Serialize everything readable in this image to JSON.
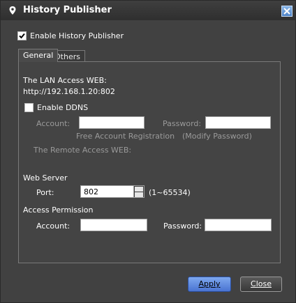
{
  "window": {
    "title": "History Publisher",
    "enable_history_publisher_label": "Enable History Publisher",
    "enable_history_publisher_checked": true
  },
  "tabs": [
    {
      "label": "General",
      "active": true
    },
    {
      "label": "Others",
      "active": false
    }
  ],
  "general": {
    "lan_access_label": "The LAN Access WEB:",
    "lan_access_url": "http://192.168.1.20:802",
    "enable_ddns_label": "Enable DDNS",
    "enable_ddns_checked": false,
    "ddns_account_label": "Account:",
    "ddns_account_value": "",
    "ddns_password_label": "Password:",
    "ddns_password_value": "",
    "free_registration_link": "Free Account Registration",
    "modify_password_link": "(Modify Password)",
    "remote_access_label": "The Remote Access WEB:",
    "web_server_heading": "Web Server",
    "port_label": "Port:",
    "port_value": "802",
    "port_range": "(1~65534)",
    "access_permission_heading": "Access Permission",
    "access_account_label": "Account:",
    "access_account_value": "",
    "access_password_label": "Password:",
    "access_password_value": ""
  },
  "buttons": {
    "apply_label": "Apply",
    "close_label": "Close"
  },
  "colors": {
    "window_bg": "#414141",
    "title_text": "#ffffff",
    "disabled_text": "#9a9a9a",
    "apply_button": "#5b87e0"
  },
  "icons": {
    "app_icon": "location-pin-icon",
    "close_icon": "close-x-icon",
    "spinner_icon": "spinner-arrows-icon"
  }
}
